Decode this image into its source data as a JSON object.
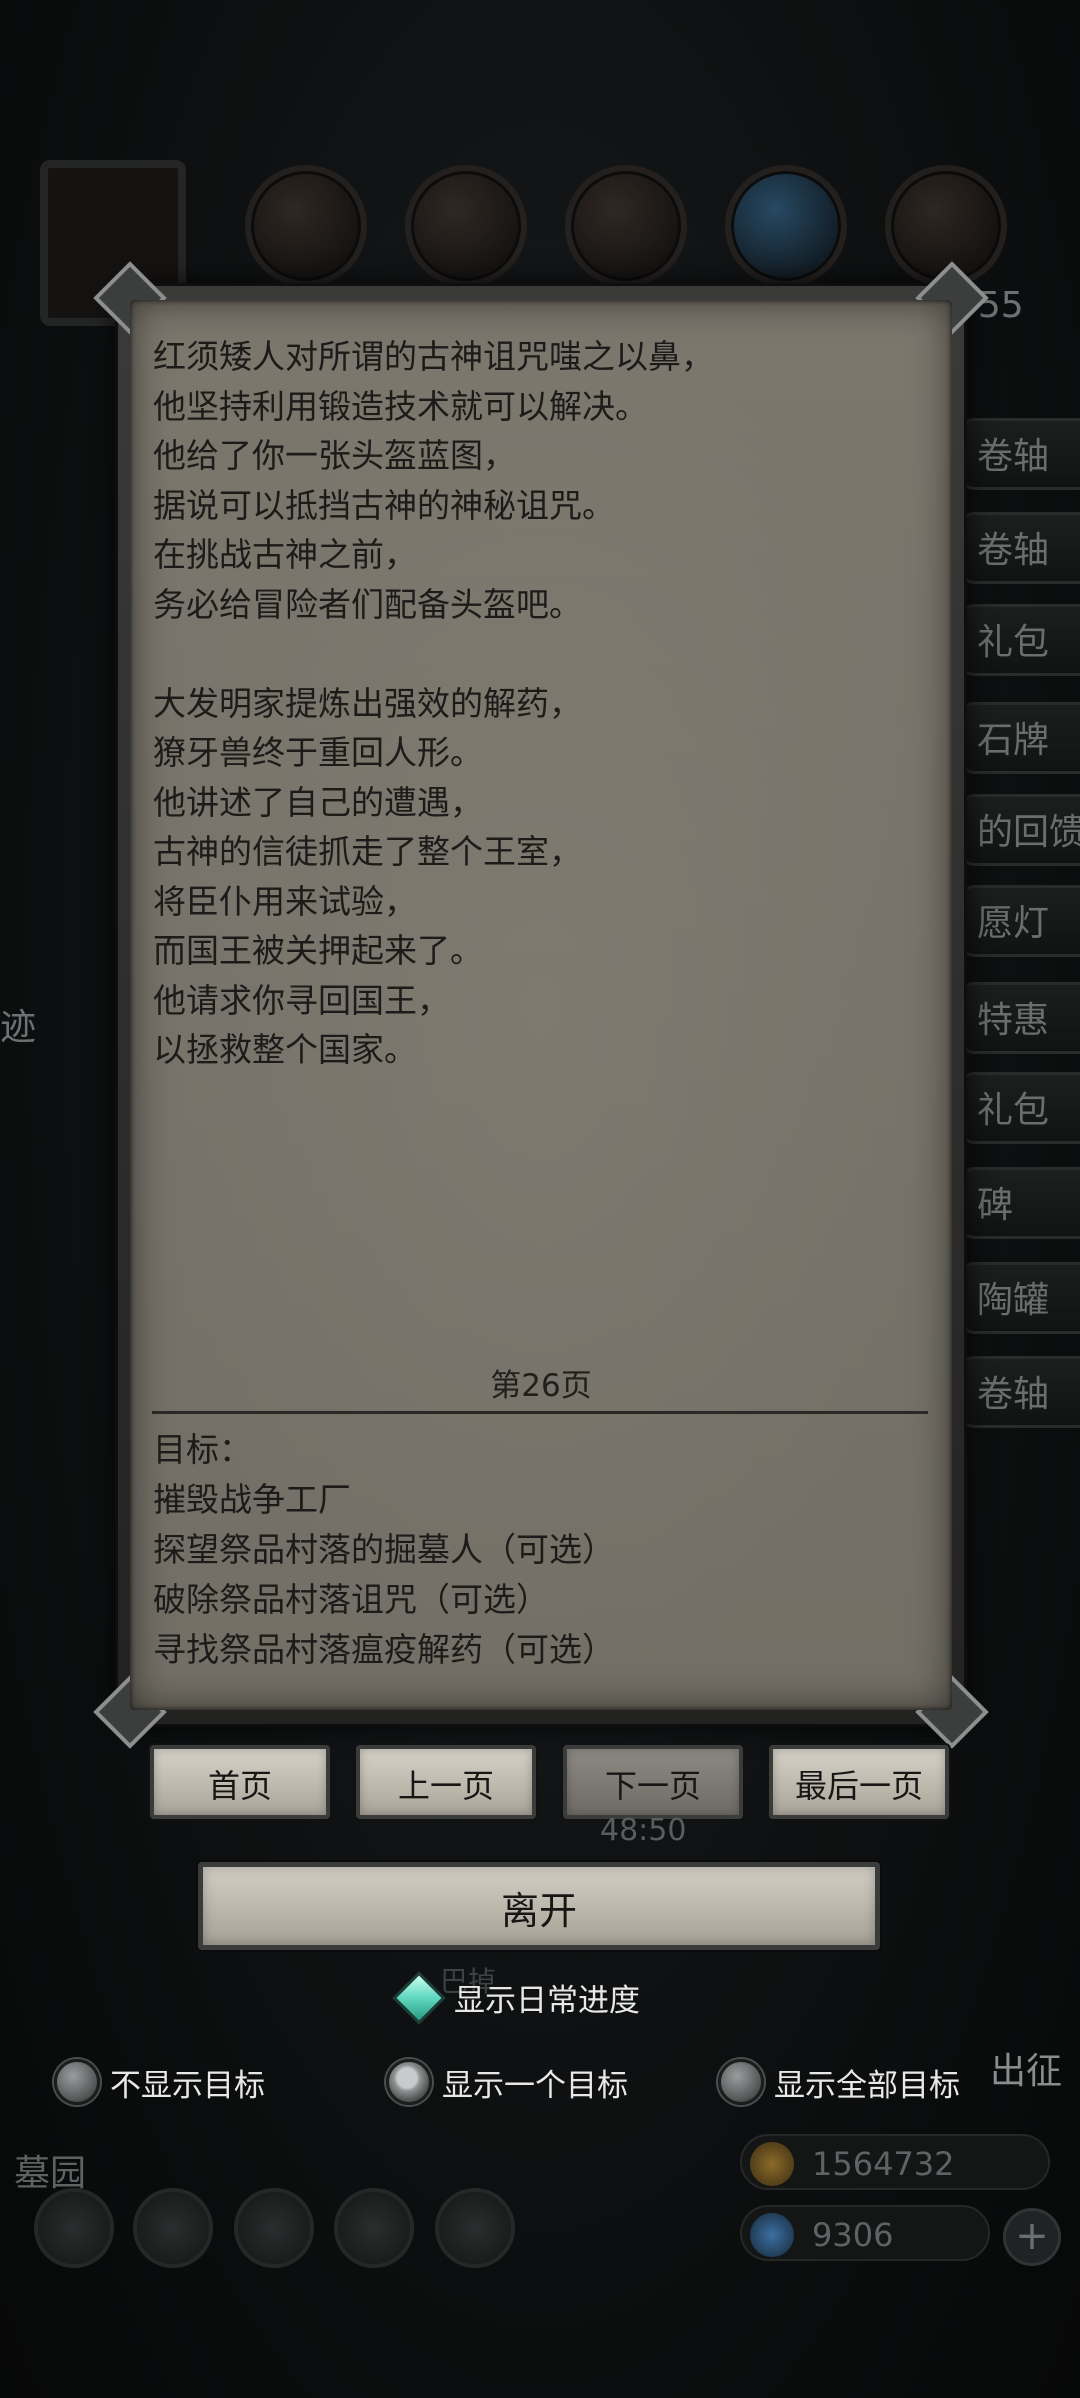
{
  "background": {
    "side_tabs": [
      "卷轴",
      "卷轴",
      "礼包",
      "石牌",
      "的回馈",
      "愿灯",
      "特惠",
      "礼包",
      "碑",
      "陶罐",
      "卷轴"
    ],
    "left_text": "迹",
    "top_right_number": "955",
    "bottom_left_label": "墓园",
    "under_leave_text": "巴掉",
    "right_label": "出征",
    "gold_value": "1564732",
    "gem_value": "9306",
    "plus_symbol": "+"
  },
  "dialog": {
    "story_lines": [
      "红须矮人对所谓的古神诅咒嗤之以鼻，",
      "他坚持利用锻造技术就可以解决。",
      "他给了你一张头盔蓝图，",
      "据说可以抵挡古神的神秘诅咒。",
      "在挑战古神之前，",
      "务必给冒险者们配备头盔吧。",
      "",
      "大发明家提炼出强效的解药，",
      "獠牙兽终于重回人形。",
      "他讲述了自己的遭遇，",
      "古神的信徒抓走了整个王室，",
      "将臣仆用来试验，",
      "而国王被关押起来了。",
      "他请求你寻回国王，",
      "以拯救整个国家。"
    ],
    "page_label": "第26页",
    "goals_title": "目标：",
    "goals": [
      "摧毁战争工厂",
      "探望祭品村落的掘墓人（可选）",
      "破除祭品村落诅咒（可选）",
      "寻找祭品村落瘟疫解药（可选）"
    ]
  },
  "nav": {
    "first": "首页",
    "prev": "上一页",
    "next": "下一页",
    "last": "最后一页"
  },
  "timer": "48:50",
  "leave_label": "离开",
  "options": {
    "show_daily": "显示日常进度",
    "hide_goals": "不显示目标",
    "show_one": "显示一个目标",
    "show_all": "显示全部目标"
  },
  "colors": {
    "parchment": "#7a756b",
    "text": "#1c1b19",
    "accent_diamond": "#5fd7be"
  }
}
